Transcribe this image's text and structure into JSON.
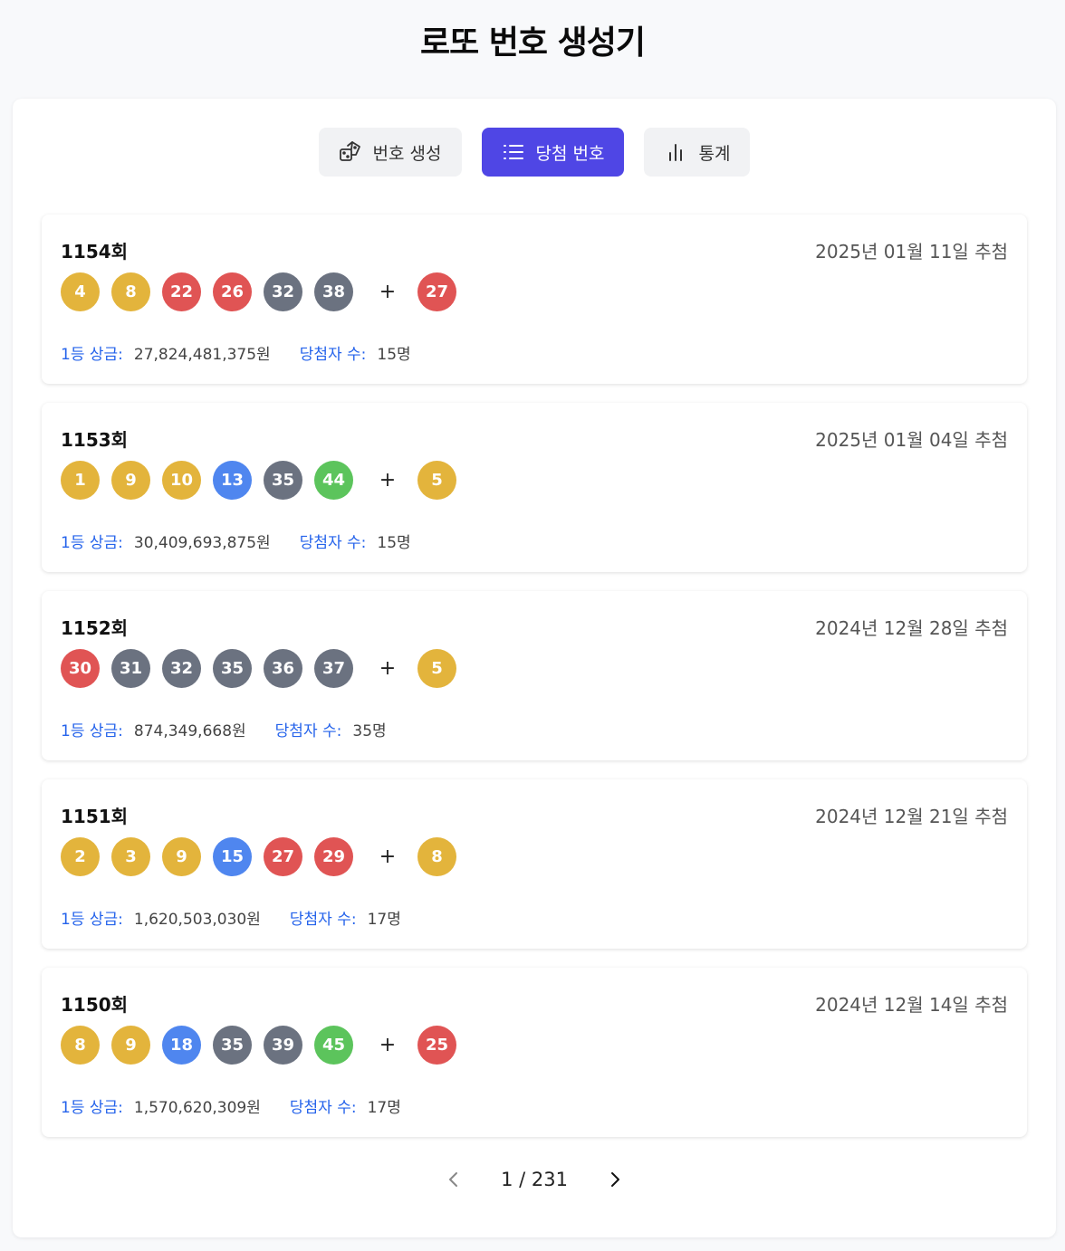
{
  "title": "로또 번호 생성기",
  "tabs": [
    {
      "label": "번호 생성",
      "icon": "dice-icon",
      "active": false
    },
    {
      "label": "당첨 번호",
      "icon": "list-icon",
      "active": true
    },
    {
      "label": "통계",
      "icon": "bar-chart-icon",
      "active": false
    }
  ],
  "colors": {
    "yellow": "#e3b43c",
    "blue": "#4f86ef",
    "red": "#e05454",
    "gray": "#6b7280",
    "green": "#5cc45c",
    "accent": "#4f46e5",
    "label_blue": "#2563eb"
  },
  "prize_label": "1등 상금:",
  "winners_label": "당첨자 수:",
  "draws": [
    {
      "round": "1154회",
      "date": "2025년 01월 11일 추첨",
      "numbers": [
        "4",
        "8",
        "22",
        "26",
        "32",
        "38"
      ],
      "plus": "+",
      "bonus": "27",
      "prize": "27,824,481,375원",
      "winners": "15명"
    },
    {
      "round": "1153회",
      "date": "2025년 01월 04일 추첨",
      "numbers": [
        "1",
        "9",
        "10",
        "13",
        "35",
        "44"
      ],
      "plus": "+",
      "bonus": "5",
      "prize": "30,409,693,875원",
      "winners": "15명"
    },
    {
      "round": "1152회",
      "date": "2024년 12월 28일 추첨",
      "numbers": [
        "30",
        "31",
        "32",
        "35",
        "36",
        "37"
      ],
      "plus": "+",
      "bonus": "5",
      "prize": "874,349,668원",
      "winners": "35명"
    },
    {
      "round": "1151회",
      "date": "2024년 12월 21일 추첨",
      "numbers": [
        "2",
        "3",
        "9",
        "15",
        "27",
        "29"
      ],
      "plus": "+",
      "bonus": "8",
      "prize": "1,620,503,030원",
      "winners": "17명"
    },
    {
      "round": "1150회",
      "date": "2024년 12월 14일 추첨",
      "numbers": [
        "8",
        "9",
        "18",
        "35",
        "39",
        "45"
      ],
      "plus": "+",
      "bonus": "25",
      "prize": "1,570,620,309원",
      "winners": "17명"
    }
  ],
  "pagination": {
    "text": "1 / 231"
  }
}
